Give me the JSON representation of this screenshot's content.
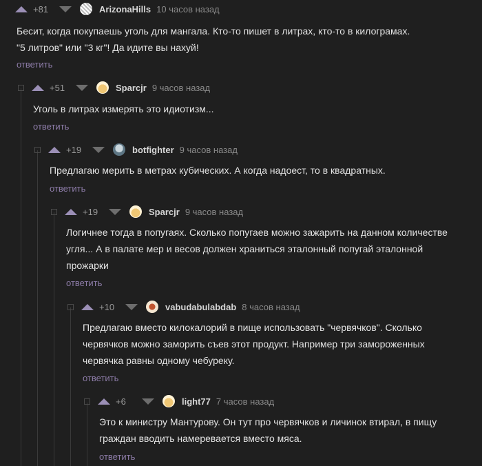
{
  "reply_label": "ответить",
  "comments": [
    {
      "rating": "+81",
      "username": "ArizonaHills",
      "time": "10 часов назад",
      "text": "Бесит, когда покупаешь уголь для мангала. Кто-то пишет в литрах, кто-то в килограмах.\n\"5 литров\" или \"3 кг\"! Да идите вы нахуй!",
      "avatar": "striped-avatar"
    },
    {
      "rating": "+51",
      "username": "Sparcjr",
      "time": "9 часов назад",
      "text": "Уголь в литрах измерять это идиотизм...",
      "avatar": "bun-avatar"
    },
    {
      "rating": "+19",
      "username": "botfighter",
      "time": "9 часов назад",
      "text": "Предлагаю мерить в метрах кубических. А когда надоест, то в квадратных.",
      "avatar": "face-avatar"
    },
    {
      "rating": "+19",
      "username": "Sparcjr",
      "time": "9 часов назад",
      "text": "Логичнее тогда в попугаях. Сколько попугаев можно зажарить на данном количестве\nугля... А в палате мер и весов должен храниться эталонный попугай эталонной\nпрожарки",
      "avatar": "bun-avatar"
    },
    {
      "rating": "+10",
      "username": "vabudabulabdab",
      "time": "8 часов назад",
      "text": "Предлагаю вместо килокалорий в пище использовать \"червячков\". Сколько\nчервячков можно заморить съев этот продукт. Например три замороженных\nчервячка равны одному чебуреку.",
      "avatar": "star-avatar"
    },
    {
      "rating": "+6",
      "username": "light77",
      "time": "7 часов назад",
      "text": "Это к министру Мантурову. Он тут про червячков и личинок втирал, в пищу\nграждан вводить намеревается вместо мяса.",
      "avatar": "bun-avatar"
    }
  ]
}
